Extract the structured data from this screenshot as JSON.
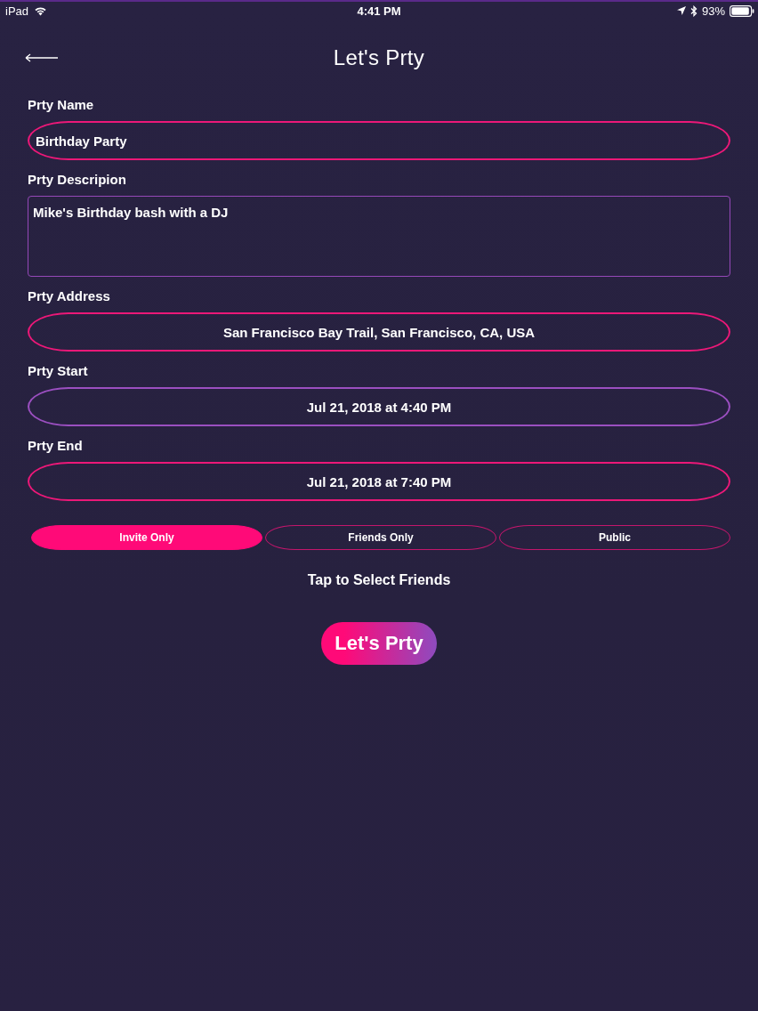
{
  "status_bar": {
    "device": "iPad",
    "time": "4:41 PM",
    "battery": "93%"
  },
  "header": {
    "title": "Let's Prty"
  },
  "fields": [
    {
      "kind": "text",
      "label": "Prty Name",
      "value": "Birthday Party",
      "color": "#ec1878"
    },
    {
      "kind": "multiline",
      "label": "Prty Descripion",
      "value": "Mike's Birthday bash with a DJ",
      "color": "#9548b8"
    },
    {
      "kind": "picker",
      "label": "Prty Address",
      "value": "San Francisco Bay Trail, San Francisco, CA, USA",
      "color": "#ec1878"
    },
    {
      "kind": "picker",
      "label": "Prty Start",
      "value": "Jul 21, 2018 at 4:40 PM",
      "color": "#9b4fc0"
    },
    {
      "kind": "picker",
      "label": "Prty End",
      "value": "Jul 21, 2018 at 7:40 PM",
      "color": "#ec1878"
    }
  ],
  "privacy_options": [
    {
      "label": "Invite Only",
      "selected": true
    },
    {
      "label": "Friends Only",
      "selected": false
    },
    {
      "label": "Public",
      "selected": false
    }
  ],
  "select_friends_link": "Tap to Select Friends",
  "submit_button": "Let's Prty"
}
